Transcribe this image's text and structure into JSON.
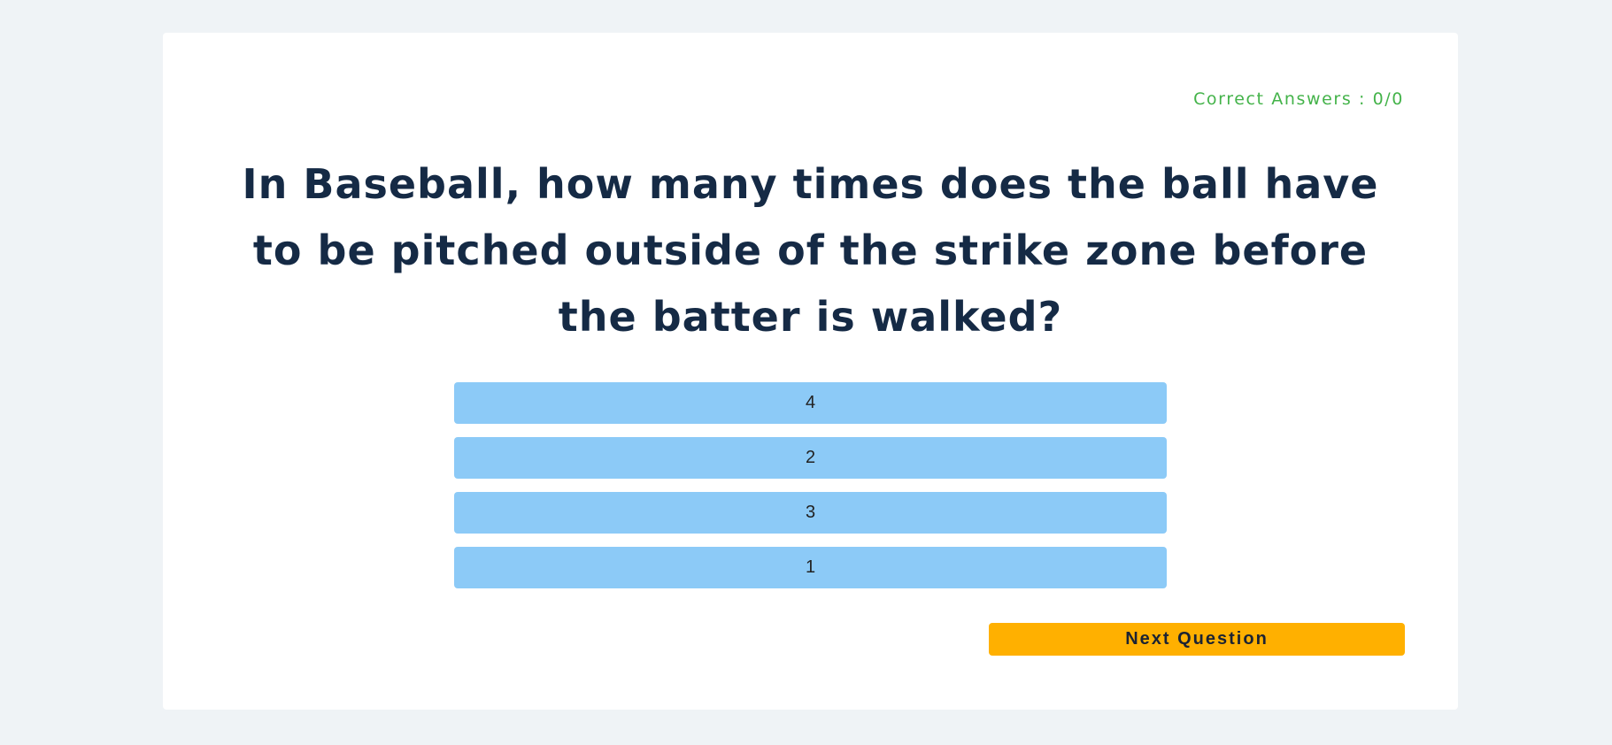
{
  "score": {
    "text": "Correct Answers : 0/0"
  },
  "question": {
    "text": "In Baseball, how many times does the ball have to be pitched outside of the strike zone before the batter is walked?"
  },
  "answers": [
    {
      "label": "4"
    },
    {
      "label": "2"
    },
    {
      "label": "3"
    },
    {
      "label": "1"
    }
  ],
  "actions": {
    "next_label": "Next Question"
  },
  "colors": {
    "background": "#eff3f6",
    "card": "#ffffff",
    "score_text": "#44b34a",
    "question_text": "#152a45",
    "answer_button": "#8ccaf7",
    "next_button": "#ffb000"
  }
}
